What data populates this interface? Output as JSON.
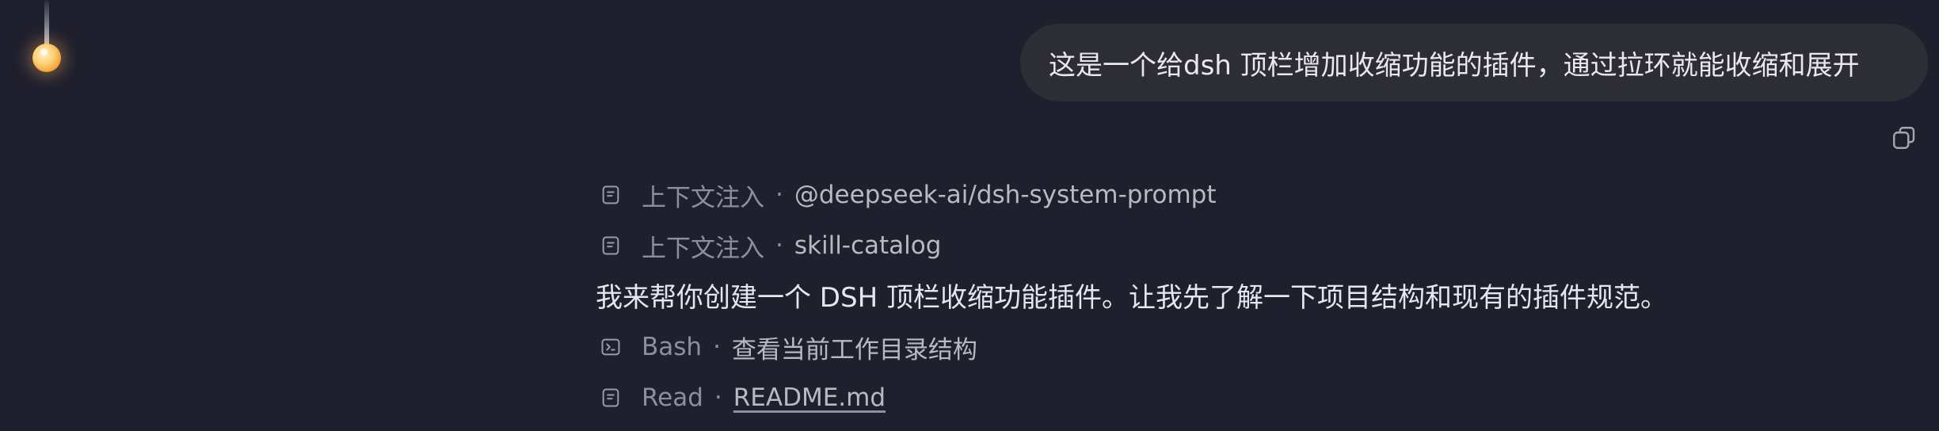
{
  "user_message": {
    "text": "这是一个给dsh 顶栏增加收缩功能的插件，通过拉环就能收缩和展开"
  },
  "assistant": {
    "context_items": [
      {
        "label": "上下文注入",
        "detail": "@deepseek-ai/dsh-system-prompt",
        "icon": "document-icon"
      },
      {
        "label": "上下文注入",
        "detail": "skill-catalog",
        "icon": "document-icon"
      }
    ],
    "reply_text": "我来帮你创建一个 DSH 顶栏收缩功能插件。让我先了解一下项目结构和现有的插件规范。",
    "tool_calls": [
      {
        "label": "Bash",
        "detail": "查看当前工作目录结构",
        "icon": "terminal-icon"
      },
      {
        "label": "Read",
        "detail": "README.md",
        "icon": "document-icon"
      }
    ],
    "separator": "·"
  },
  "colors": {
    "background": "#1f1f2e",
    "bubble": "#2d2d36",
    "muted_text": "#8e8e9c",
    "primary_text": "#e6e6ee",
    "ring_accent": "#f2a53a"
  }
}
